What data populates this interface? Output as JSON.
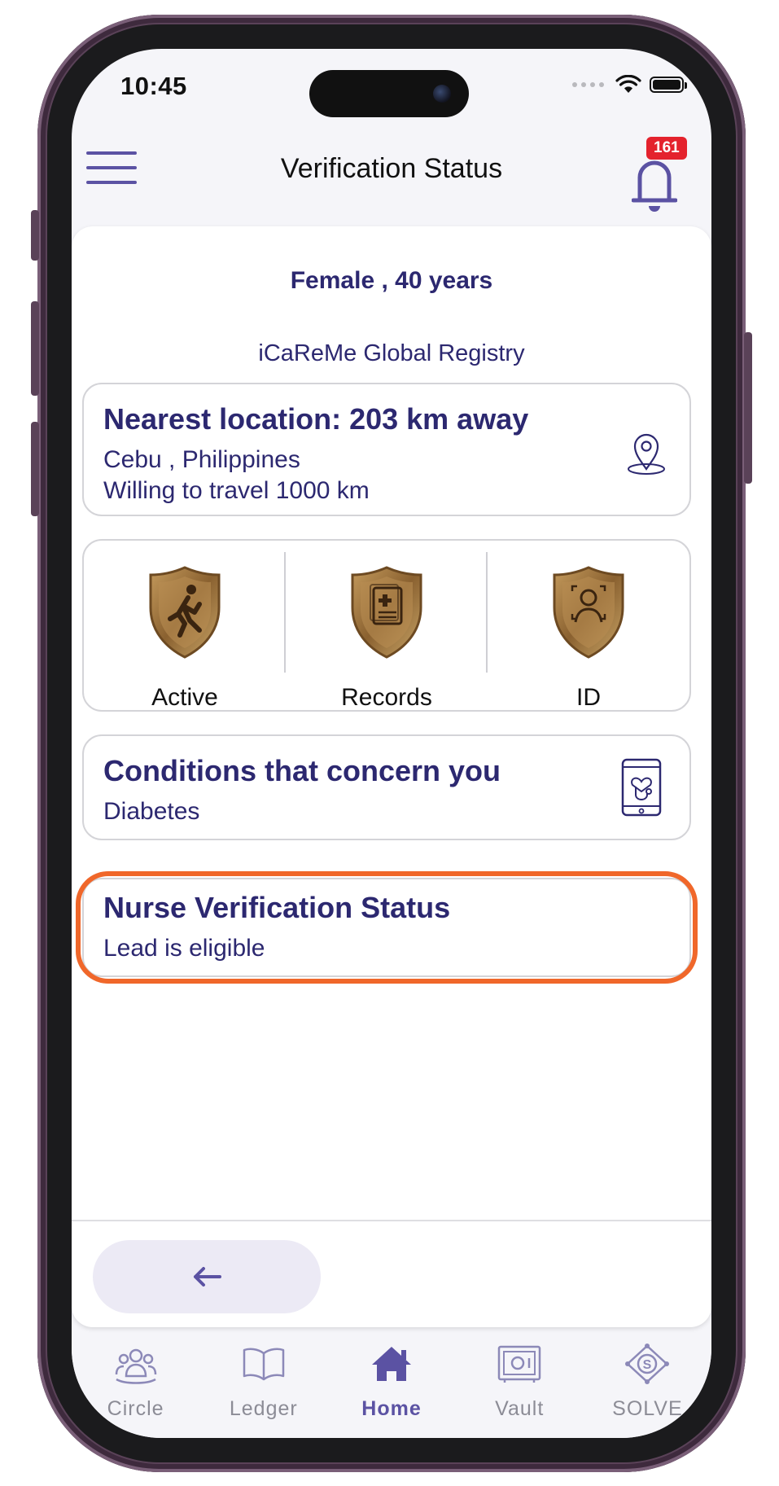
{
  "status_bar": {
    "time": "10:45"
  },
  "header": {
    "title": "Verification Status",
    "notification_count": "161"
  },
  "profile": {
    "summary": "Female , 40  years",
    "registry": "iCaReMe Global Registry"
  },
  "location_card": {
    "title": "Nearest location: 203 km away",
    "place": "Cebu , Philippines",
    "travel": "Willing to travel  1000 km"
  },
  "badges": [
    {
      "label": "Active",
      "icon": "running-person-icon"
    },
    {
      "label": "Records",
      "icon": "medical-record-icon"
    },
    {
      "label": "ID",
      "icon": "person-id-icon"
    }
  ],
  "conditions_card": {
    "title": "Conditions that concern you",
    "value": "Diabetes"
  },
  "nurse_card": {
    "title": "Nurse Verification Status",
    "status": "Lead is eligible"
  },
  "tabs": [
    {
      "label": "Circle",
      "icon": "circle-group-icon",
      "active": false
    },
    {
      "label": "Ledger",
      "icon": "book-icon",
      "active": false
    },
    {
      "label": "Home",
      "icon": "home-icon",
      "active": true
    },
    {
      "label": "Vault",
      "icon": "vault-icon",
      "active": false
    },
    {
      "label": "SOLVE",
      "icon": "solve-icon",
      "active": false
    }
  ],
  "colors": {
    "accent": "#5b52a3",
    "text_dark_blue": "#2c2870",
    "highlight": "#f0672a",
    "badge_red": "#e4222d",
    "shield_bronze": "#a07840"
  }
}
